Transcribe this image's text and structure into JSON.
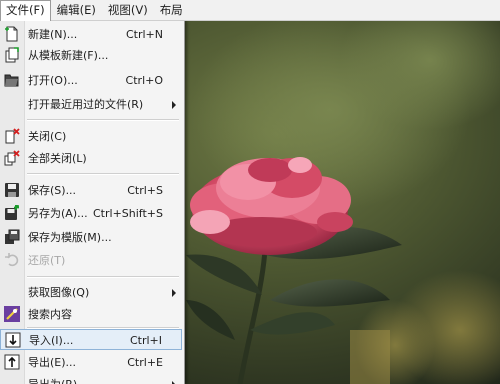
{
  "menubar": {
    "items": [
      {
        "label": "文件(F)"
      },
      {
        "label": "编辑(E)"
      },
      {
        "label": "视图(V)"
      },
      {
        "label": "布局"
      }
    ]
  },
  "file_menu": {
    "items": [
      {
        "label": "新建(N)...",
        "shortcut": "Ctrl+N",
        "icon": "new-document-icon"
      },
      {
        "label": "从模板新建(F)...",
        "shortcut": "",
        "icon": "new-from-template-icon"
      },
      {
        "label": "打开(O)...",
        "shortcut": "Ctrl+O",
        "icon": "open-folder-icon"
      },
      {
        "label": "打开最近用过的文件(R)",
        "shortcut": "",
        "icon": "",
        "submenu": true
      },
      {
        "label": "关闭(C)",
        "shortcut": "",
        "icon": "close-document-icon"
      },
      {
        "label": "全部关闭(L)",
        "shortcut": "",
        "icon": "close-all-icon"
      },
      {
        "label": "保存(S)...",
        "shortcut": "Ctrl+S",
        "icon": "save-icon"
      },
      {
        "label": "另存为(A)...",
        "shortcut": "Ctrl+Shift+S",
        "icon": "save-as-icon"
      },
      {
        "label": "保存为模版(M)...",
        "shortcut": "",
        "icon": "save-as-template-icon"
      },
      {
        "label": "还原(T)",
        "shortcut": "",
        "icon": "revert-icon",
        "disabled": true
      },
      {
        "label": "获取图像(Q)",
        "shortcut": "",
        "icon": "",
        "submenu": true
      },
      {
        "label": "搜索内容",
        "shortcut": "",
        "icon": "search-content-icon"
      },
      {
        "label": "导入(I)...",
        "shortcut": "Ctrl+I",
        "icon": "import-icon",
        "highlighted": true
      },
      {
        "label": "导出(E)...",
        "shortcut": "Ctrl+E",
        "icon": "export-icon"
      },
      {
        "label": "导出为(R)",
        "shortcut": "",
        "icon": "",
        "submenu": true
      }
    ]
  },
  "colors": {
    "menu_bg": "#f4f4f4",
    "highlight_bg": "#e4eef8",
    "highlight_border": "#8eb3d8",
    "disabled_text": "#a7a7a7",
    "flower": "#d6506a"
  }
}
